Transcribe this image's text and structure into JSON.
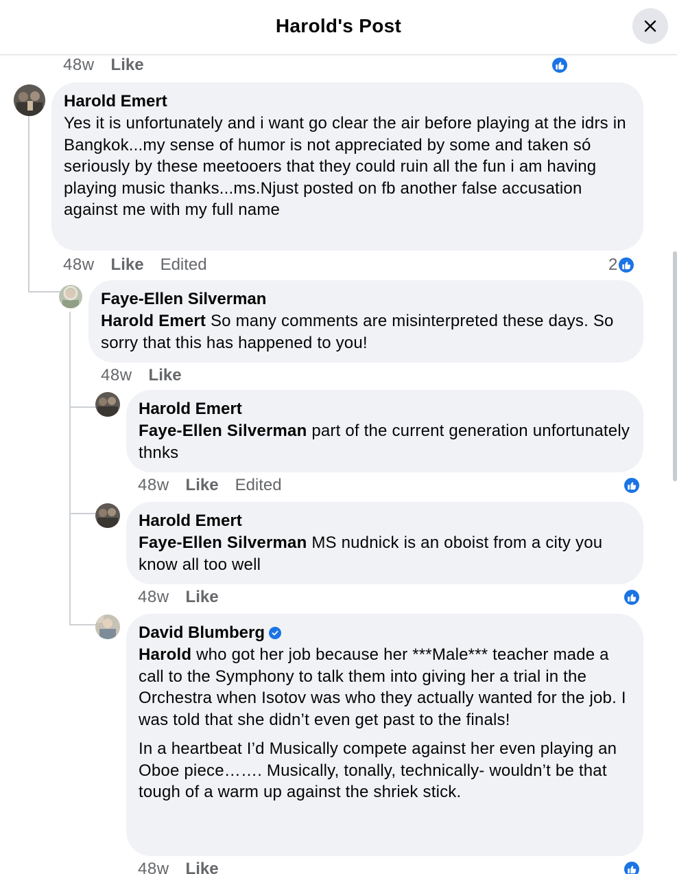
{
  "header": {
    "title": "Harold's Post"
  },
  "colors": {
    "accent": "#1b74e4",
    "bubble": "#f0f2f5",
    "meta_text": "#65676b"
  },
  "comments": [
    {
      "time": "48w",
      "like_label": "Like"
    },
    {
      "author": "Harold Emert",
      "text": "Yes it is unfortunately and i want go clear the air before playing at the idrs in Bangkok...my sense of humor is not appreciated by some and taken só seriously by these meetooers that they could ruin all the fun i am having playing music thanks...ms.Njust posted on fb another false accusation against me with my full name",
      "time": "48w",
      "like_label": "Like",
      "edited_label": "Edited",
      "reaction_count": "2"
    },
    {
      "author": "Faye-Ellen Silverman",
      "mention": "Harold Emert",
      "text": " So many comments are misinterpreted these days. So sorry that this has happened to you!",
      "time": "48w",
      "like_label": "Like"
    },
    {
      "author": "Harold Emert",
      "mention": "Faye-Ellen Silverman",
      "text": " part of the current generation unfortunately thnks",
      "time": "48w",
      "like_label": "Like",
      "edited_label": "Edited"
    },
    {
      "author": "Harold Emert",
      "mention": "Faye-Ellen Silverman",
      "text": " MS nudnick is an oboist from a city you know all too well",
      "time": "48w",
      "like_label": "Like"
    },
    {
      "author": "David Blumberg",
      "mention": "Harold",
      "text": " who got her job because her ***Male*** teacher made a call to the Symphony to talk them into giving her a trial in the Orchestra when Isotov was who they actually wanted for the job. I was told that she didn’t even get past to the finals!",
      "text2": "In a heartbeat I’d Musically compete against her even playing an Oboe piece……. Musically, tonally, technically- wouldn’t be that tough of a warm up against the shriek stick.",
      "time": "48w",
      "like_label": "Like"
    }
  ]
}
